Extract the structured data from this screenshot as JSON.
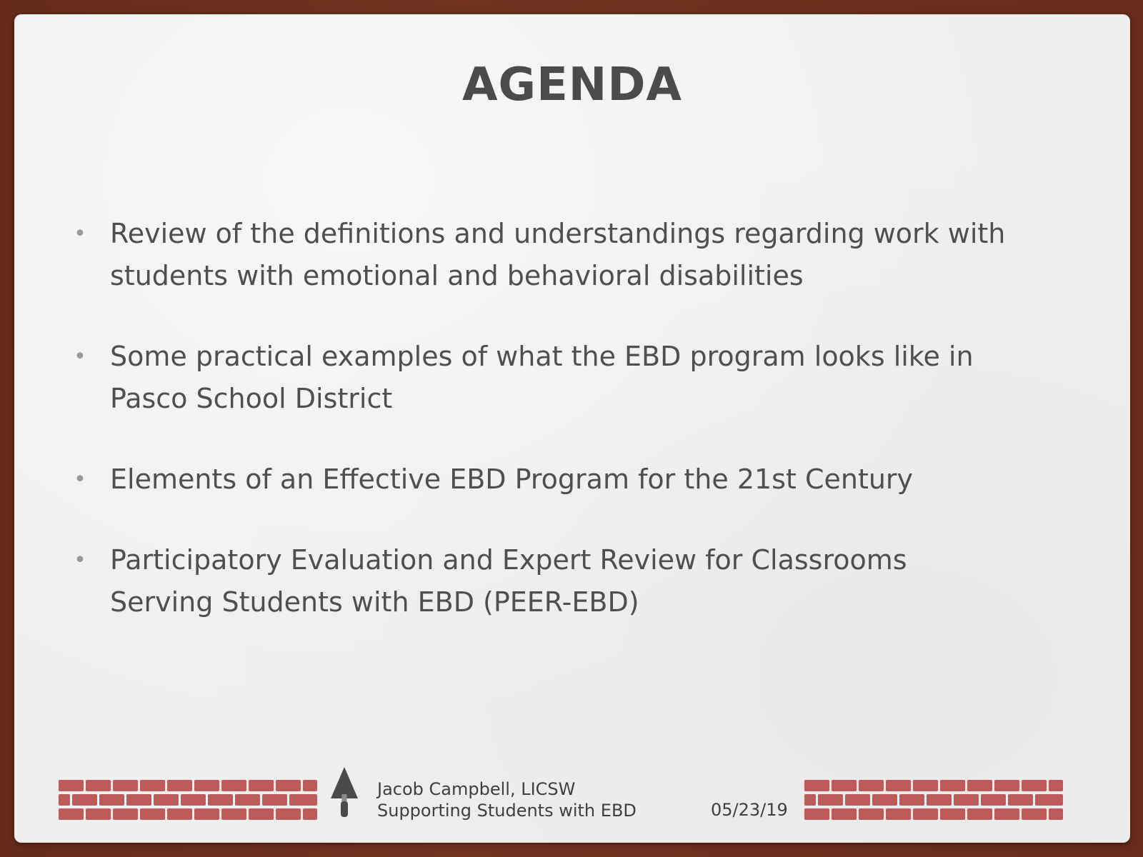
{
  "slide": {
    "title": "AGENDA",
    "bullets": [
      {
        "lines": [
          "Review of the definitions and understandings regarding work with",
          "students with emotional and behavioral disabilities"
        ]
      },
      {
        "lines": [
          "Some practical examples of what the EBD program looks like in",
          "Pasco School District"
        ]
      },
      {
        "lines": [
          "Elements of an Effective EBD Program for the 21st Century"
        ]
      },
      {
        "lines": [
          "Participatory Evaluation and Expert Review for Classrooms",
          "Serving Students with EBD (PEER-EBD)"
        ]
      }
    ],
    "bullet_glyph": "•"
  },
  "footer": {
    "author": "Jacob Campbell, LICSW",
    "presentation": "Supporting Students with EBD",
    "date": "05/23/19",
    "icons": [
      "brick-wall-icon",
      "trowel-icon"
    ]
  },
  "colors": {
    "frame": "#6e2f1c",
    "slide_background": "#efefed",
    "text": "#4f4f4d",
    "brick": "#bd5a5a"
  }
}
